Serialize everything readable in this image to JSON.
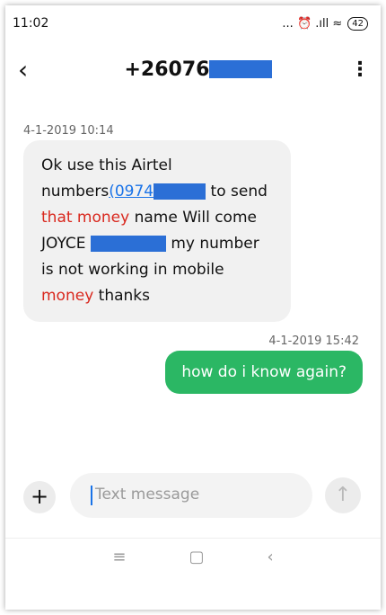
{
  "status": {
    "time": "11:02",
    "icons": "... ⏰ .ıll ≈",
    "battery": "42"
  },
  "header": {
    "number_prefix": "+26076",
    "back_glyph": "‹",
    "more_glyph": "⋮"
  },
  "messages": {
    "incoming_timestamp": "4-1-2019 10:14",
    "incoming": {
      "part1": "Ok use this Airtel numbers",
      "link": "(0974",
      "part2": " to send ",
      "red1": "that money",
      "part3": " name Will come JOYCE",
      "part4": " my number is not working in mobile ",
      "red2": "money",
      "part5": " thanks"
    },
    "outgoing_timestamp": "4-1-2019 15:42",
    "outgoing": "how do i know again?"
  },
  "composer": {
    "plus": "+",
    "placeholder": "Text message",
    "send_glyph": "↑"
  },
  "navbar": {
    "menu": "≡",
    "home": "▢",
    "back": "‹"
  },
  "colors": {
    "redaction": "#2b6fd6",
    "outgoing_bubble": "#2bb764",
    "red_text": "#d9281e"
  }
}
